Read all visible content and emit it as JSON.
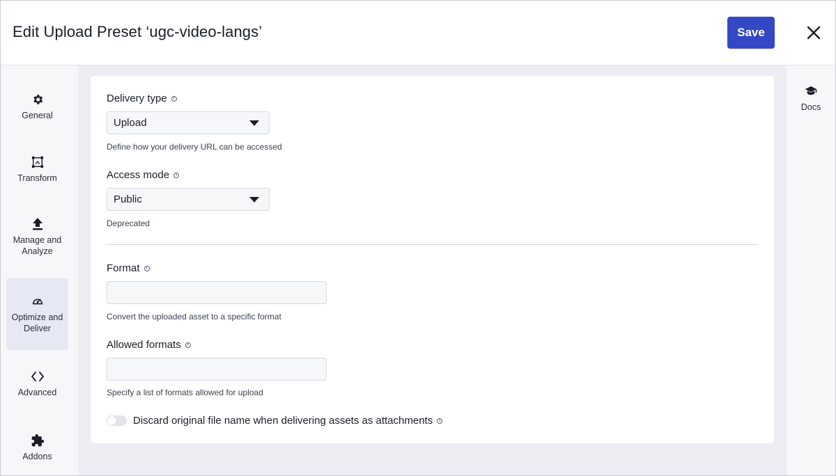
{
  "header": {
    "title": "Edit Upload Preset ‘ugc-video-langs’",
    "save_label": "Save",
    "close_icon": "close-icon"
  },
  "sidebar": {
    "items": [
      {
        "label": "General",
        "icon": "gear-icon"
      },
      {
        "label": "Transform",
        "icon": "transform-icon"
      },
      {
        "label": "Manage and Analyze",
        "icon": "upload-icon"
      },
      {
        "label": "Optimize and Deliver",
        "icon": "gauge-icon",
        "active": true
      },
      {
        "label": "Advanced",
        "icon": "code-icon"
      },
      {
        "label": "Addons",
        "icon": "puzzle-icon"
      }
    ]
  },
  "right_panel": {
    "docs_label": "Docs",
    "docs_icon": "graduation-cap-icon"
  },
  "form": {
    "delivery_type": {
      "label": "Delivery type",
      "value": "Upload",
      "helper": "Define how your delivery URL can be accessed"
    },
    "access_mode": {
      "label": "Access mode",
      "value": "Public",
      "helper": "Deprecated"
    },
    "format": {
      "label": "Format",
      "value": "",
      "helper": "Convert the uploaded asset to a specific format"
    },
    "allowed_formats": {
      "label": "Allowed formats",
      "value": "",
      "helper": "Specify a list of formats allowed for upload"
    },
    "discard_filename": {
      "label": "Discard original file name when delivering assets as attachments",
      "enabled": false
    }
  },
  "colors": {
    "accent": "#3448c5",
    "background": "#eceef3",
    "card": "#ffffff"
  }
}
